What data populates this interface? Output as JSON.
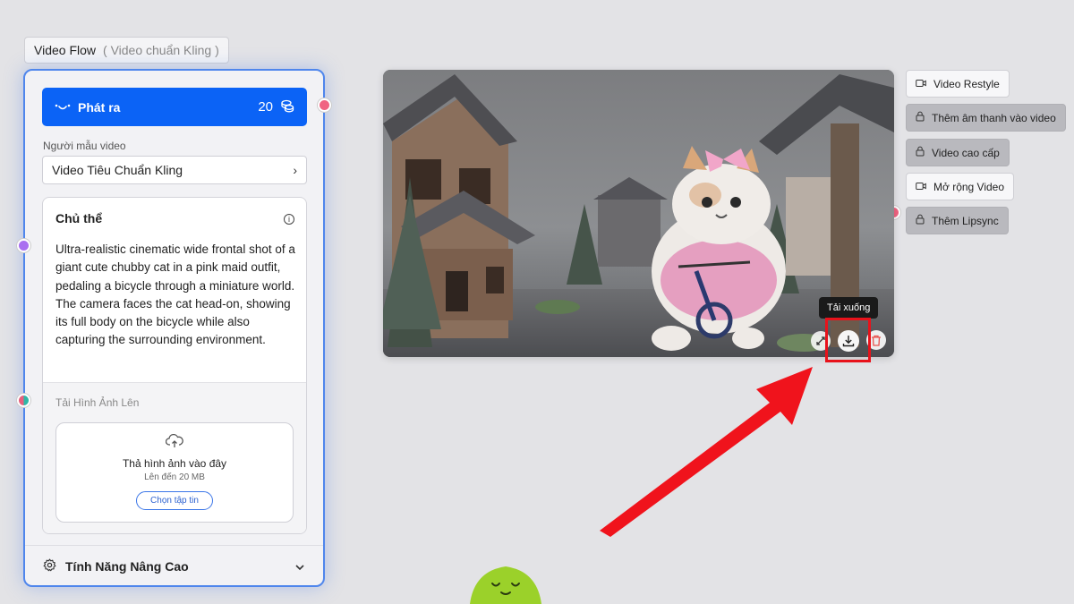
{
  "flow_label": {
    "title": "Video Flow",
    "subtitle": "( Video chuẩn Kling )"
  },
  "panel": {
    "generate_label": "Phát ra",
    "generate_count": "20",
    "model_label": "Người mẫu video",
    "model_value": "Video Tiêu Chuẩn Kling",
    "subject_title": "Chủ thể",
    "prompt": "Ultra-realistic cinematic wide frontal shot of a giant cute chubby cat in a pink maid outfit, pedaling a bicycle through a miniature world. The camera faces the cat head-on, showing its full body on the bicycle while also capturing the surrounding environment.",
    "upload_label": "Tải Hình Ảnh Lên",
    "drop_text": "Thả hình ảnh vào đây",
    "drop_limit": "Lên đến 20 MB",
    "choose_file": "Chọn tập tin",
    "advanced_label": "Tính Năng Nâng Cao"
  },
  "video": {
    "tooltip": "Tải xuống"
  },
  "right_menu": [
    {
      "label": "Video Restyle",
      "icon": "video-camera-icon",
      "locked": false
    },
    {
      "label": "Thêm âm thanh vào video",
      "icon": "lock-icon",
      "locked": true
    },
    {
      "label": "Video cao cấp",
      "icon": "lock-icon",
      "locked": true
    },
    {
      "label": "Mở rộng Video",
      "icon": "video-camera-icon",
      "locked": false
    },
    {
      "label": "Thêm Lipsync",
      "icon": "lock-icon",
      "locked": true
    }
  ],
  "colors": {
    "accent": "#0b63f6",
    "highlight": "#e8121b",
    "port_pink": "#f06382",
    "port_purple": "#a970f0",
    "port_teal": "#2fb7a7"
  }
}
